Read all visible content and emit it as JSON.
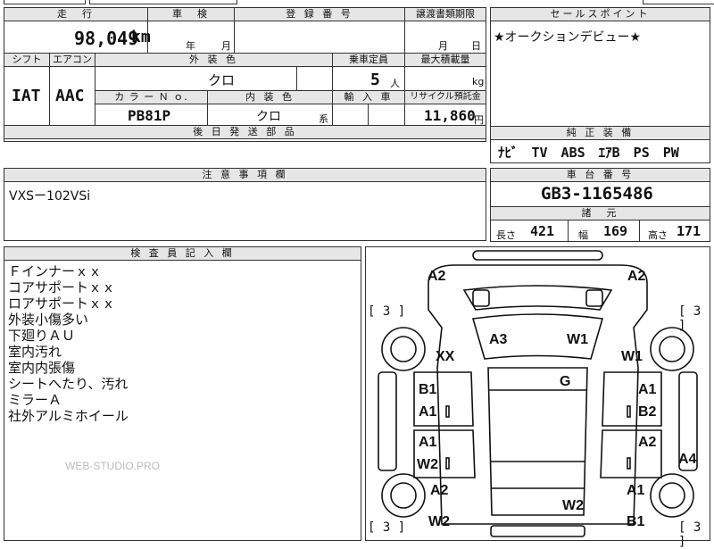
{
  "top_strip": {},
  "row1": {
    "mileage_header": "走　行",
    "mileage_value": "98,049",
    "mileage_unit": "km",
    "inspection_header": "車　検",
    "inspection_year": "年",
    "inspection_month": "月",
    "registration_header": "登 録 番 号",
    "transfer_header": "譲渡書類期限",
    "transfer_month": "月",
    "transfer_day": "日"
  },
  "row2": {
    "shift_header": "シフト",
    "aircon_header": "エアコン",
    "exterior_color_header": "外 装 色",
    "capacity_header": "乗車定員",
    "max_load_header": "最大積載量",
    "shift_value": "IAT",
    "aircon_value": "AAC",
    "exterior_color_value": "クロ",
    "capacity_value": "5",
    "capacity_unit": "人",
    "max_load_unit": "kg",
    "color_no_header": "カ ラ ー Ｎ ｏ.",
    "interior_color_header": "内 装 色",
    "import_header": "輸 入 車",
    "recycle_header": "リサイクル預託金",
    "color_no_value": "PB81P",
    "interior_color_value": "クロ",
    "interior_suffix": "系",
    "recycle_value": "11,860",
    "recycle_unit": "円",
    "later_parts_header": "後 日 発 送 部 品"
  },
  "sales_point": {
    "header": "セールスポイント",
    "text": "★オークションデビュー★"
  },
  "equipment": {
    "header": "純 正 装 備",
    "text": "ﾅﾋﾞ　TV　ABS　ｴｱB　PS　PW"
  },
  "notes": {
    "header": "注 意 事 項 欄",
    "text": "VXSー102VSi"
  },
  "chassis": {
    "header": "車 台 番 号",
    "value": "GB3-1165486",
    "spec_header": "諸　元",
    "length_label": "長さ",
    "length_value": "421",
    "width_label": "幅",
    "width_value": "169",
    "height_label": "高さ",
    "height_value": "171"
  },
  "inspector": {
    "header": "検 査 員 記 入 欄",
    "lines": [
      "Ｆインナーｘｘ",
      "コアサポートｘｘ",
      "ロアサポートｘｘ",
      "外装小傷多い",
      "下廻りＡＵ",
      "室内汚れ",
      "室内内張傷",
      "シートへたり、汚れ",
      "ミラーＡ",
      "社外アルミホイール"
    ],
    "watermark": "WEB-STUDIO.PRO"
  },
  "diagram": {
    "tire_marks": [
      "[ 3 ]",
      "[ 3 ]",
      "[ 3 ]",
      "[ 3 ]"
    ],
    "marks": {
      "a2_fl": "A2",
      "a2_fr": "A2",
      "a3": "A3",
      "w1_hood": "W1",
      "xx": "XX",
      "w1_r": "W1",
      "g": "G",
      "b1_l": "B1",
      "a1_l1": "A1",
      "a1_r1": "A1",
      "b2_r": "B2",
      "a1_l2": "A1",
      "w2_l": "W2",
      "a2_r2": "A2",
      "a4": "A4",
      "a2_l3": "A2",
      "a1_r3": "A1",
      "w2_l4": "W2",
      "w2_roof": "W2",
      "b1_r4": "B1"
    }
  }
}
